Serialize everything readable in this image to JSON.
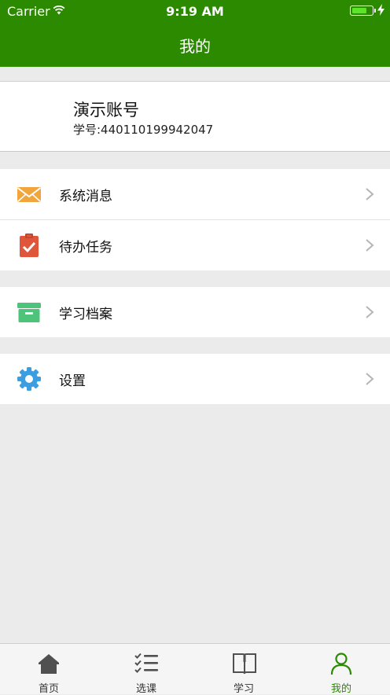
{
  "status_bar": {
    "carrier": "Carrier",
    "time": "9:19 AM"
  },
  "nav": {
    "title": "我的"
  },
  "profile": {
    "name": "演示账号",
    "student_id": "学号:440110199942047"
  },
  "menu_groups": [
    {
      "items": [
        {
          "label": "系统消息",
          "icon": "envelope-icon"
        },
        {
          "label": "待办任务",
          "icon": "clipboard-check-icon"
        }
      ]
    },
    {
      "items": [
        {
          "label": "学习档案",
          "icon": "archive-drawer-icon"
        }
      ]
    },
    {
      "items": [
        {
          "label": "设置",
          "icon": "gear-icon"
        }
      ]
    }
  ],
  "tabbar": {
    "items": [
      {
        "label": "首页",
        "icon": "home-icon"
      },
      {
        "label": "选课",
        "icon": "checklist-icon"
      },
      {
        "label": "学习",
        "icon": "book-icon"
      },
      {
        "label": "我的",
        "icon": "user-icon",
        "active": true
      }
    ]
  },
  "colors": {
    "brand": "#2b8a00",
    "background": "#ebebeb"
  }
}
